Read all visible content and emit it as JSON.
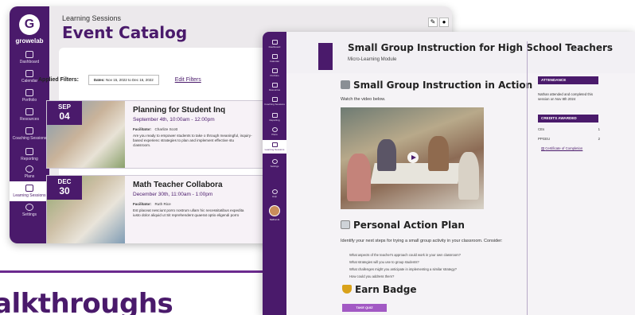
{
  "back_window": {
    "brand": {
      "logo_letter": "G",
      "name": "growelab"
    },
    "nav": [
      {
        "label": "Dashboard",
        "icon": "dashboard-icon"
      },
      {
        "label": "Calendar",
        "icon": "calendar-icon"
      },
      {
        "label": "Portfolio",
        "icon": "portfolio-icon"
      },
      {
        "label": "Resources",
        "icon": "book-icon"
      },
      {
        "label": "Coaching Sessions",
        "icon": "chat-icon"
      },
      {
        "label": "Reporting",
        "icon": "chart-icon"
      },
      {
        "label": "Plans",
        "icon": "compass-icon"
      },
      {
        "label": "Learning Sessions",
        "icon": "graduation-cap-icon"
      },
      {
        "label": "Settings",
        "icon": "gear-icon"
      }
    ],
    "breadcrumb": "Learning Sessions",
    "title": "Event Catalog",
    "filters": {
      "label": "Applied Filters:",
      "pill_key": "Dates:",
      "pill_value": "Nov 15, 2022 to Dec 16, 2022",
      "edit_link": "Edit Filters"
    },
    "events": [
      {
        "month": "SEP",
        "day": "04",
        "title": "Planning for Student Inq",
        "datetime": "September 4th, 10:00am - 12:00pm",
        "facilitator_label": "Facilitator:",
        "facilitator": "Charlize Scott",
        "description": "Are you ready to empower students to take o through meaningful, inquiry-based experienc strategies to plan and implement effective stu classroom."
      },
      {
        "month": "DEC",
        "day": "30",
        "title": "Math Teacher Collabora",
        "datetime": "December 30th, 11:00am - 1:00pm",
        "facilitator_label": "Facilitator:",
        "facilitator": "Ruth Rice",
        "description": "Est placeat nesciunt porro nostrum ullam hic necessitatibus expedita iusto dolor aliquid ut Sit reprehendent quaerat optio eligendi porro"
      }
    ]
  },
  "front_window": {
    "nav": [
      {
        "label": "Dashboard"
      },
      {
        "label": "Calendar"
      },
      {
        "label": "Portfolio"
      },
      {
        "label": "Resources"
      },
      {
        "label": "Coaching Sessions"
      },
      {
        "label": "Reporting"
      },
      {
        "label": "Plans"
      },
      {
        "label": "Learning Sessions"
      },
      {
        "label": "Settings"
      },
      {
        "label": "Help"
      }
    ],
    "user_name": "Nathan E",
    "module_title": "Small Group Instruction for High School Teachers",
    "module_subtitle": "Micro-Learning Module",
    "section1_title": "Small Group Instruction in Action",
    "section1_intro": "Watch the video below.",
    "section2_title": "Personal Action Plan",
    "section2_intro": "Identify your next steps for trying a small group activity in your classroom. Consider:",
    "questions": [
      "What aspects of the teacher's approach could work in your own classroom?",
      "What strategies will you use to group students?",
      "What challenges might you anticipate in implementing a similar strategy?",
      "How could you address them?"
    ],
    "section3_title": "Earn Badge",
    "quiz_button": "TAKE QUIZ",
    "attendance": {
      "heading": "ATTENDANCE",
      "text": "Nathan attended and completed this session on Nov 8th 2024"
    },
    "credits": {
      "heading": "CREDITS AWARDED",
      "rows": [
        {
          "label": "CEs",
          "value": "1"
        },
        {
          "label": "PPGEU",
          "value": "2"
        }
      ],
      "certificate_link": "Certificate of Completion"
    }
  },
  "page_heading": "alkthroughs",
  "colors": {
    "brand_purple": "#4a1a6b",
    "accent_purple": "#a259c4"
  }
}
